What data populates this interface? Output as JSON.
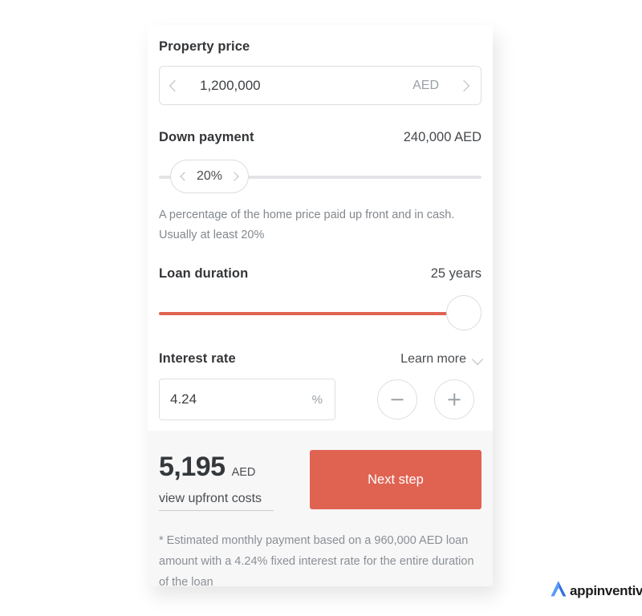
{
  "property_price": {
    "label": "Property price",
    "value": "1,200,000",
    "currency": "AED",
    "prev_icon": "chevron-left-icon",
    "next_icon": "chevron-right-icon"
  },
  "down_payment": {
    "label": "Down payment",
    "amount": "240,000 AED",
    "percent": "20%",
    "helper": "A percentage of the home price paid up front and in cash. Usually at least 20%",
    "dec_icon": "chevron-left-icon",
    "inc_icon": "chevron-right-icon"
  },
  "loan_duration": {
    "label": "Loan duration",
    "value": "25 years"
  },
  "interest_rate": {
    "label": "Interest rate",
    "learn_more": "Learn more",
    "learn_more_icon": "chevron-down-icon",
    "value": "4.24",
    "unit": "%",
    "decrease_icon": "minus-icon",
    "increase_icon": "plus-icon"
  },
  "summary": {
    "amount": "5,195",
    "currency": "AED",
    "upfront_link": "view upfront costs",
    "next_button": "Next step",
    "disclaimer": "* Estimated monthly payment based on a 960,000 AED loan amount with a 4.24% fixed interest rate for the entire duration of the loan"
  },
  "branding": {
    "name": "appinventiv",
    "mark": "appinventiv-logo-icon"
  },
  "colors": {
    "accent": "#e06352",
    "track": "#e3e4e6",
    "panel": "#f7f7f8",
    "logo_blue": "#3b82f6"
  }
}
